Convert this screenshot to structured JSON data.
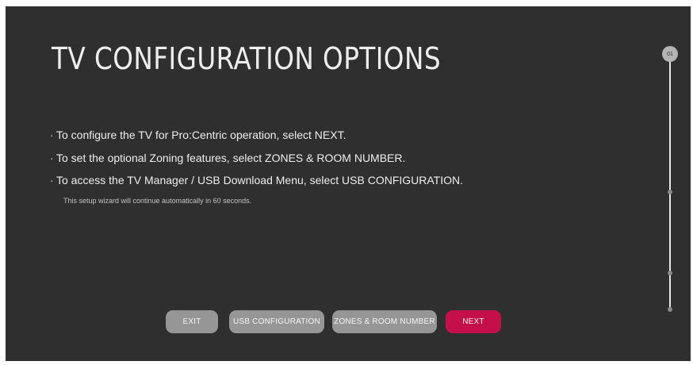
{
  "page": {
    "title": "TV CONFIGURATION OPTIONS",
    "instructions": [
      "To configure the TV for Pro:Centric operation, select NEXT.",
      "To set the optional Zoning features, select ZONES & ROOM NUMBER.",
      "To access the TV Manager / USB Download Menu, select USB CONFIGURATION."
    ],
    "bullet_glyph": "·",
    "auto_continue_note": "This setup wizard will continue automatically in 60 seconds."
  },
  "buttons": {
    "exit": "EXIT",
    "usb_configuration": "USB CONFIGURATION",
    "zones_room_number": "ZONES & ROOM NUMBER",
    "next": "NEXT"
  },
  "progress": {
    "current_step_label": "01"
  },
  "colors": {
    "background": "#302f30",
    "button": "#969696",
    "accent": "#c3104a"
  }
}
